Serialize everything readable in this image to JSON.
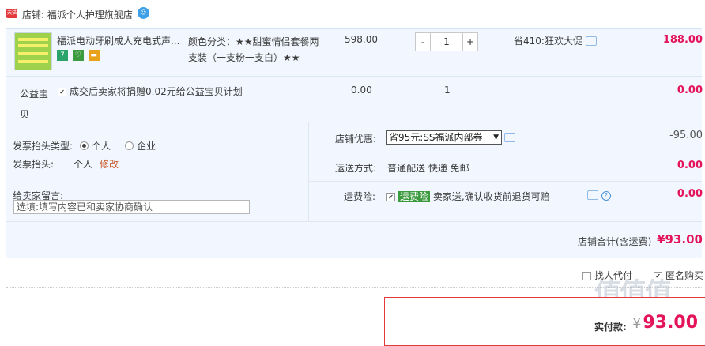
{
  "shop": {
    "logo_text": "天猫",
    "label": "店铺:",
    "name": "福派个人护理旗舰店"
  },
  "item": {
    "title": "福派电动牙刷成人充电式声...",
    "sku": "颜色分类：★★甜蜜情侣套餐两支装（一支粉一支白）★★",
    "price": "598.00",
    "quantity": "1",
    "qty_minus": "-",
    "qty_plus": "+",
    "promo": "省410:狂欢大促",
    "subtotal": "188.00",
    "mini_icons": [
      "7",
      "♡",
      "▬"
    ],
    "thumb_colors": {
      "bg": "#9ed24c",
      "band": "#f5f06a"
    }
  },
  "charity": {
    "label": "公益宝贝",
    "checked": "✔",
    "text": "成交后卖家将捐赠0.02元给公益宝贝计划",
    "price": "0.00",
    "qty": "1",
    "total": "0.00"
  },
  "invoice": {
    "type_label": "发票抬头类型:",
    "personal": "个人",
    "company": "企业",
    "head_label": "发票抬头:",
    "head_value": "个人",
    "edit": "修改"
  },
  "message": {
    "label": "给卖家留言:",
    "placeholder": "选填:填写内容已和卖家协商确认"
  },
  "discount": {
    "label": "店铺优惠:",
    "selected": "省95元:SS福派内部券",
    "arrow": "▼",
    "amount": "-95.00"
  },
  "shipping": {
    "label": "运送方式:",
    "value": "普通配送 快递 免邮",
    "amount": "0.00"
  },
  "insurance": {
    "label": "运费险:",
    "checked": "✔",
    "tag": "运费险",
    "text": " 卖家送,确认收货前退货可赔",
    "help": "?",
    "amount": "0.00"
  },
  "shop_total": {
    "label": "店铺合计(含运费)",
    "amount": "¥93.00"
  },
  "options": {
    "proxy": "找人代付",
    "anonymous": "匿名购买",
    "anon_check": "✔"
  },
  "pay": {
    "label": "实付款:",
    "yen": "¥",
    "amount": "93.00"
  },
  "watermark": "值值值",
  "colors": {
    "price_red": "#e4145a",
    "panel_bg": "#f2f7ff",
    "border_red": "#e4393c",
    "green_tag": "#3c9a3f"
  }
}
